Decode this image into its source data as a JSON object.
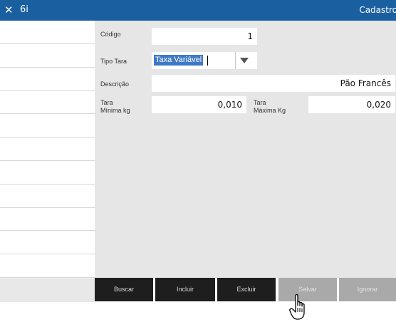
{
  "titlebar": {
    "close_glyph": "✕",
    "app_name": "6i",
    "screen_title": "Cadastro",
    "color": "#1a5fa0"
  },
  "sidebar": {
    "row_count": 11
  },
  "form": {
    "codigo_label": "Código",
    "codigo_value": "1",
    "tipo_tara_label": "Tipo Tara",
    "tipo_tara_value": "Taxa Variável",
    "descricao_label": "Descrição",
    "descricao_value": "Pão Francês",
    "tara_minima_label_line1": "Tara",
    "tara_minima_label_line2": "Mínima kg",
    "tara_minima_value": "0,010",
    "tara_maxima_label_line1": "Tara",
    "tara_maxima_label_line2": "Máxima Kg",
    "tara_maxima_value": "0,020"
  },
  "buttons": {
    "buscar": "Buscar",
    "incluir": "Incluir",
    "excluir": "Excluir",
    "salvar": "Salvar",
    "ignorar": "Ignorar"
  },
  "colors": {
    "button_dark": "#1e1e1e",
    "button_disabled": "#a9a9a9",
    "selection": "#3f79c6"
  },
  "icons": {
    "close": "close-icon",
    "dropdown": "chevron-down-icon",
    "cursor": "hand-pointer-icon"
  }
}
